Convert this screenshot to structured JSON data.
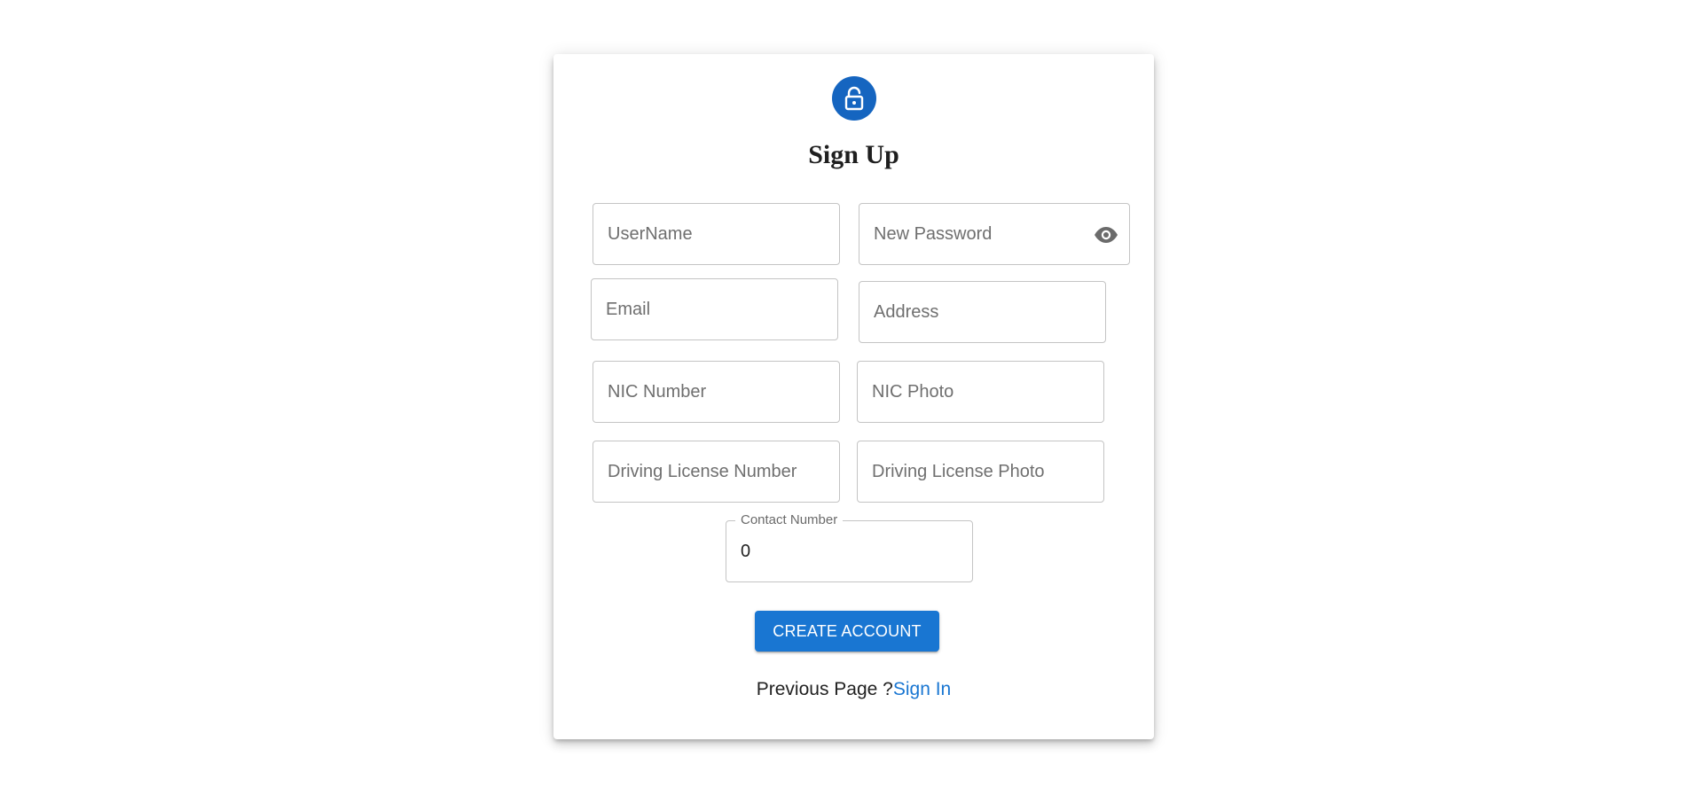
{
  "form": {
    "title": "Sign Up",
    "lock_icon": "lock-open-icon",
    "fields": {
      "username": {
        "placeholder": "UserName",
        "value": ""
      },
      "new_password": {
        "placeholder": "New Password",
        "value": "",
        "visibility_icon": "eye-icon"
      },
      "email": {
        "placeholder": "Email",
        "value": ""
      },
      "address": {
        "placeholder": "Address",
        "value": ""
      },
      "nic_number": {
        "placeholder": "NIC Number",
        "value": ""
      },
      "nic_photo": {
        "placeholder": "NIC Photo",
        "value": ""
      },
      "driving_license_number": {
        "placeholder": "Driving License Number",
        "value": ""
      },
      "driving_license_photo": {
        "placeholder": "Driving License Photo",
        "value": ""
      },
      "contact_number": {
        "label": "Contact Number",
        "value": "0"
      }
    },
    "submit_label": "CREATE ACCOUNT",
    "footer": {
      "prompt": "Previous Page ?",
      "link_label": "Sign In"
    }
  },
  "colors": {
    "accent": "#1976d2",
    "avatar_bg": "#1565c0",
    "border": "#c4c4c4",
    "placeholder": "#6f6f6f"
  }
}
